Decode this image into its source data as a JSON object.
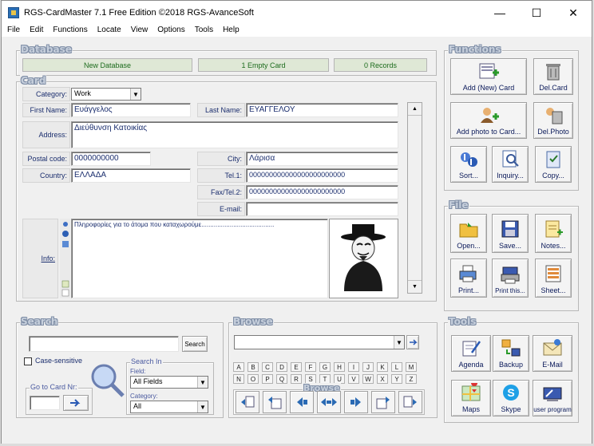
{
  "window": {
    "title": "RGS-CardMaster 7.1 Free Edition ©2018 RGS-AvanceSoft",
    "minimize": "—",
    "maximize": "☐",
    "close": "✕"
  },
  "menu": [
    "File",
    "Edit",
    "Functions",
    "Locate",
    "View",
    "Options",
    "Tools",
    "Help"
  ],
  "database": {
    "title": "Database",
    "new_database": "New Database",
    "empty_card": "1 Empty Card",
    "records": "0 Records"
  },
  "card": {
    "title": "Card",
    "category_label": "Category:",
    "category_value": "Work",
    "first_name_label": "First Name:",
    "first_name_value": "Ευάγγελος",
    "last_name_label": "Last Name:",
    "last_name_value": "ΕΥΑΓΓΕΛΟΥ",
    "address_label": "Address:",
    "address_value": "Διεύθυνση Κατοικίας",
    "postal_label": "Postal code:",
    "postal_value": "0000000000",
    "city_label": "City:",
    "city_value": "Λάρισα",
    "country_label": "Country:",
    "country_value": "ΕΛΛΑΔΑ",
    "tel1_label": "Tel.1:",
    "tel1_value": "000000000000000000000000",
    "fax_label": "Fax/Tel.2:",
    "fax_value": "000000000000000000000000",
    "email_label": "E-mail:",
    "email_value": "",
    "info_label": "Info:",
    "info_value": "Πληροφορίες για το άτομα που καταχωρούμε........................................."
  },
  "functions": {
    "title": "Functions",
    "add_card": "Add (New) Card",
    "del_card": "Del.Card",
    "add_photo": "Add photo to Card...",
    "del_photo": "Del.Photo",
    "sort": "Sort...",
    "inquiry": "Inquiry...",
    "copy": "Copy..."
  },
  "file": {
    "title": "File",
    "open": "Open...",
    "save": "Save...",
    "notes": "Notes...",
    "print": "Print...",
    "print_this": "Print this...",
    "sheet": "Sheet..."
  },
  "search": {
    "title": "Search",
    "input_value": "",
    "search_button": "Search",
    "case_sensitive": "Case-sensitive",
    "search_in": "Search In",
    "field_label": "Field:",
    "field_value": "All Fields",
    "category_label": "Category:",
    "category_value": "All",
    "goto_card": "Go to Card Nr:",
    "goto_value": ""
  },
  "browse": {
    "title": "Browse",
    "combo_value": "",
    "letters_row1": [
      "A",
      "B",
      "C",
      "D",
      "E",
      "F",
      "G",
      "H",
      "I",
      "J",
      "K",
      "L",
      "M"
    ],
    "letters_row2": [
      "N",
      "O",
      "P",
      "Q",
      "R",
      "S",
      "T",
      "U",
      "V",
      "W",
      "X",
      "Y",
      "Z"
    ],
    "nav_title": "Browse"
  },
  "tools": {
    "title": "Tools",
    "agenda": "Agenda",
    "backup": "Backup",
    "email": "E-Mail",
    "maps": "Maps",
    "skype": "Skype",
    "user_program": "user program"
  },
  "colors": {
    "label_text": "#1b2e6e",
    "bar_green": "#1c6b1c",
    "group_title": "#c6cfdc"
  }
}
